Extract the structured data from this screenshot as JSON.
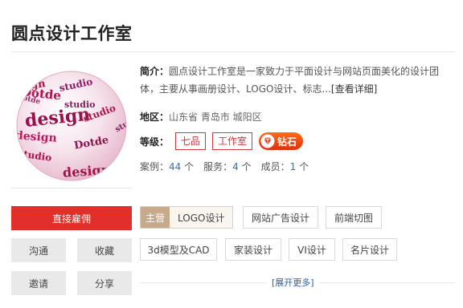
{
  "studio": {
    "name": "圆点设计工作室"
  },
  "intro": {
    "label": "简介：",
    "text": "圆点设计工作室是一家致力于平面设计与网站页面美化的设计团体，主要从事画册设计、LOGO设计、标志...",
    "more_link": "[查看详细]"
  },
  "region": {
    "label": "地区：",
    "value": "山东省 青岛市 城阳区"
  },
  "grade": {
    "label": "等级：",
    "badges": [
      "七品",
      "工作室"
    ],
    "diamond_label": "钻石"
  },
  "stats": {
    "cases_label": "案例：",
    "cases_value": "44",
    "cases_unit": "个",
    "services_label": "服务：",
    "services_value": "4",
    "services_unit": "个",
    "members_label": "成员：",
    "members_value": "1",
    "members_unit": "个"
  },
  "actions": {
    "hire": "直接雇佣",
    "communicate": "沟通",
    "favorite": "收藏",
    "invite": "邀请",
    "share": "分享"
  },
  "services": {
    "main_label": "主营",
    "main_value": "LOGO设计",
    "tags": [
      "网站广告设计",
      "前端切图",
      "3d模型及CAD",
      "家装设计",
      "VI设计",
      "名片设计"
    ],
    "expand": "[展开更多]"
  },
  "colors": {
    "accent_red": "#e32f2a",
    "link_blue": "#3a6fb4",
    "logo_magenta": "#c2185b"
  },
  "logo": {
    "words": [
      "design",
      "studio",
      "Dotde",
      "studio",
      "design",
      "studio",
      "design",
      "Dotde",
      "studio",
      "design"
    ]
  }
}
